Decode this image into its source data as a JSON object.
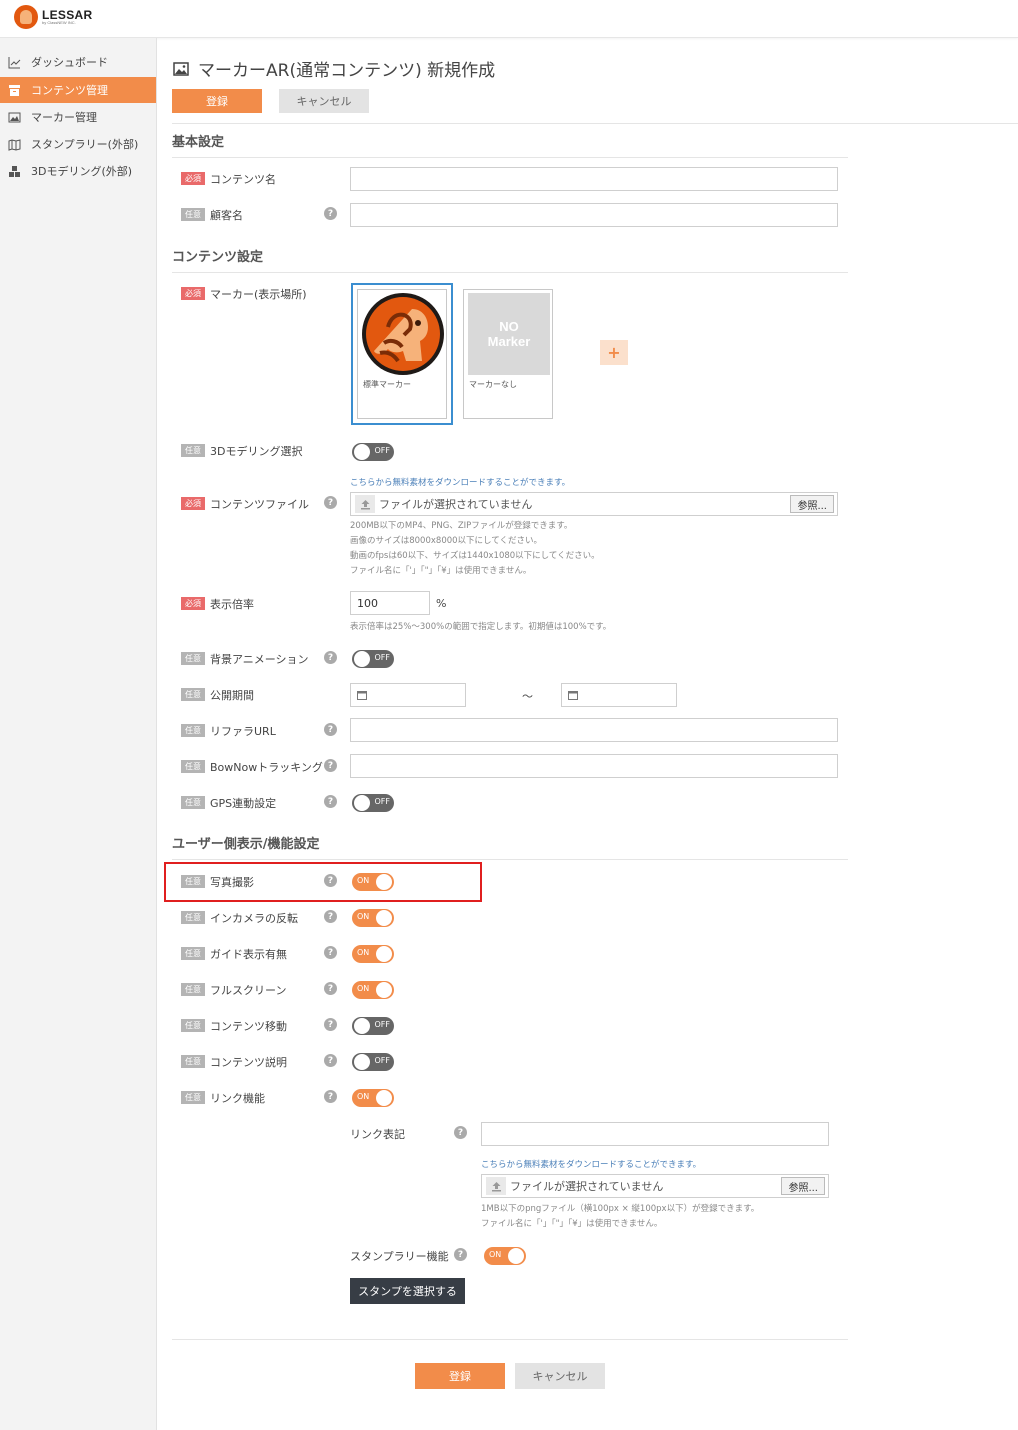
{
  "header": {
    "logo_text": "LESSAR",
    "logo_sub": "by ClassNEW INC."
  },
  "sidebar": {
    "items": [
      {
        "label": "ダッシュボード"
      },
      {
        "label": "コンテンツ管理"
      },
      {
        "label": "マーカー管理"
      },
      {
        "label": "スタンプラリー(外部)"
      },
      {
        "label": "3Dモデリング(外部)"
      }
    ]
  },
  "page": {
    "title": "マーカーAR(通常コンテンツ) 新規作成"
  },
  "actions": {
    "submit": "登録",
    "cancel": "キャンセル"
  },
  "badges": {
    "required": "必須",
    "optional": "任意"
  },
  "sections": {
    "basic": "基本設定",
    "content": "コンテンツ設定",
    "user": "ユーザー側表示/機能設定"
  },
  "fields": {
    "content_name": {
      "label": "コンテンツ名",
      "value": ""
    },
    "customer_name": {
      "label": "顧客名",
      "value": ""
    },
    "marker": {
      "label": "マーカー(表示場所)",
      "options": [
        {
          "caption": "標準マーカー",
          "selected": true
        },
        {
          "caption": "マーカーなし",
          "placeholder": "NO Marker",
          "selected": false
        }
      ],
      "add_symbol": "+"
    },
    "modeling": {
      "label": "3Dモデリング選択",
      "state": "OFF"
    },
    "content_file": {
      "label": "コンテンツファイル",
      "download_link": "こちらから無料素材をダウンロードすることができます。",
      "placeholder": "ファイルが選択されていません",
      "browse": "参照...",
      "notes": [
        "200MB以下のMP4、PNG、ZIPファイルが登録できます。",
        "画像のサイズは8000x8000以下にしてください。",
        "動画のfpsは60以下、サイズは1440x1080以下にしてください。",
        "ファイル名に「'」「\"」「¥」は使用できません。"
      ]
    },
    "scale": {
      "label": "表示倍率",
      "value": "100",
      "unit": "%",
      "note": "表示倍率は25%〜300%の範囲で指定します。初期値は100%です。"
    },
    "bg_animation": {
      "label": "背景アニメーション",
      "state": "OFF"
    },
    "period": {
      "label": "公開期間",
      "sep": "〜",
      "start": "",
      "end": ""
    },
    "referer_url": {
      "label": "リファラURL",
      "value": ""
    },
    "bownow": {
      "label": "BowNowトラッキング",
      "value": ""
    },
    "gps": {
      "label": "GPS連動設定",
      "state": "OFF"
    },
    "photo": {
      "label": "写真撮影",
      "state": "ON"
    },
    "in_camera": {
      "label": "インカメラの反転",
      "state": "ON"
    },
    "guide": {
      "label": "ガイド表示有無",
      "state": "ON"
    },
    "fullscreen": {
      "label": "フルスクリーン",
      "state": "ON"
    },
    "move": {
      "label": "コンテンツ移動",
      "state": "OFF"
    },
    "description": {
      "label": "コンテンツ説明",
      "state": "OFF"
    },
    "link": {
      "label": "リンク機能",
      "state": "ON"
    },
    "link_text": {
      "label": "リンク表記",
      "value": ""
    },
    "link_file": {
      "download_link": "こちらから無料素材をダウンロードすることができます。",
      "placeholder": "ファイルが選択されていません",
      "browse": "参照...",
      "notes": [
        "1MB以下のpngファイル（横100px × 縦100px以下）が登録できます。",
        "ファイル名に「'」「\"」「¥」は使用できません。"
      ]
    },
    "stamp_rally": {
      "label": "スタンプラリー機能",
      "state": "ON",
      "select_button": "スタンプを選択する"
    }
  },
  "colors": {
    "accent": "#f28c4a",
    "required": "#e96a6a",
    "optional": "#b4b4b4",
    "highlight": "#e01f1f",
    "selected": "#3b8ed0"
  }
}
